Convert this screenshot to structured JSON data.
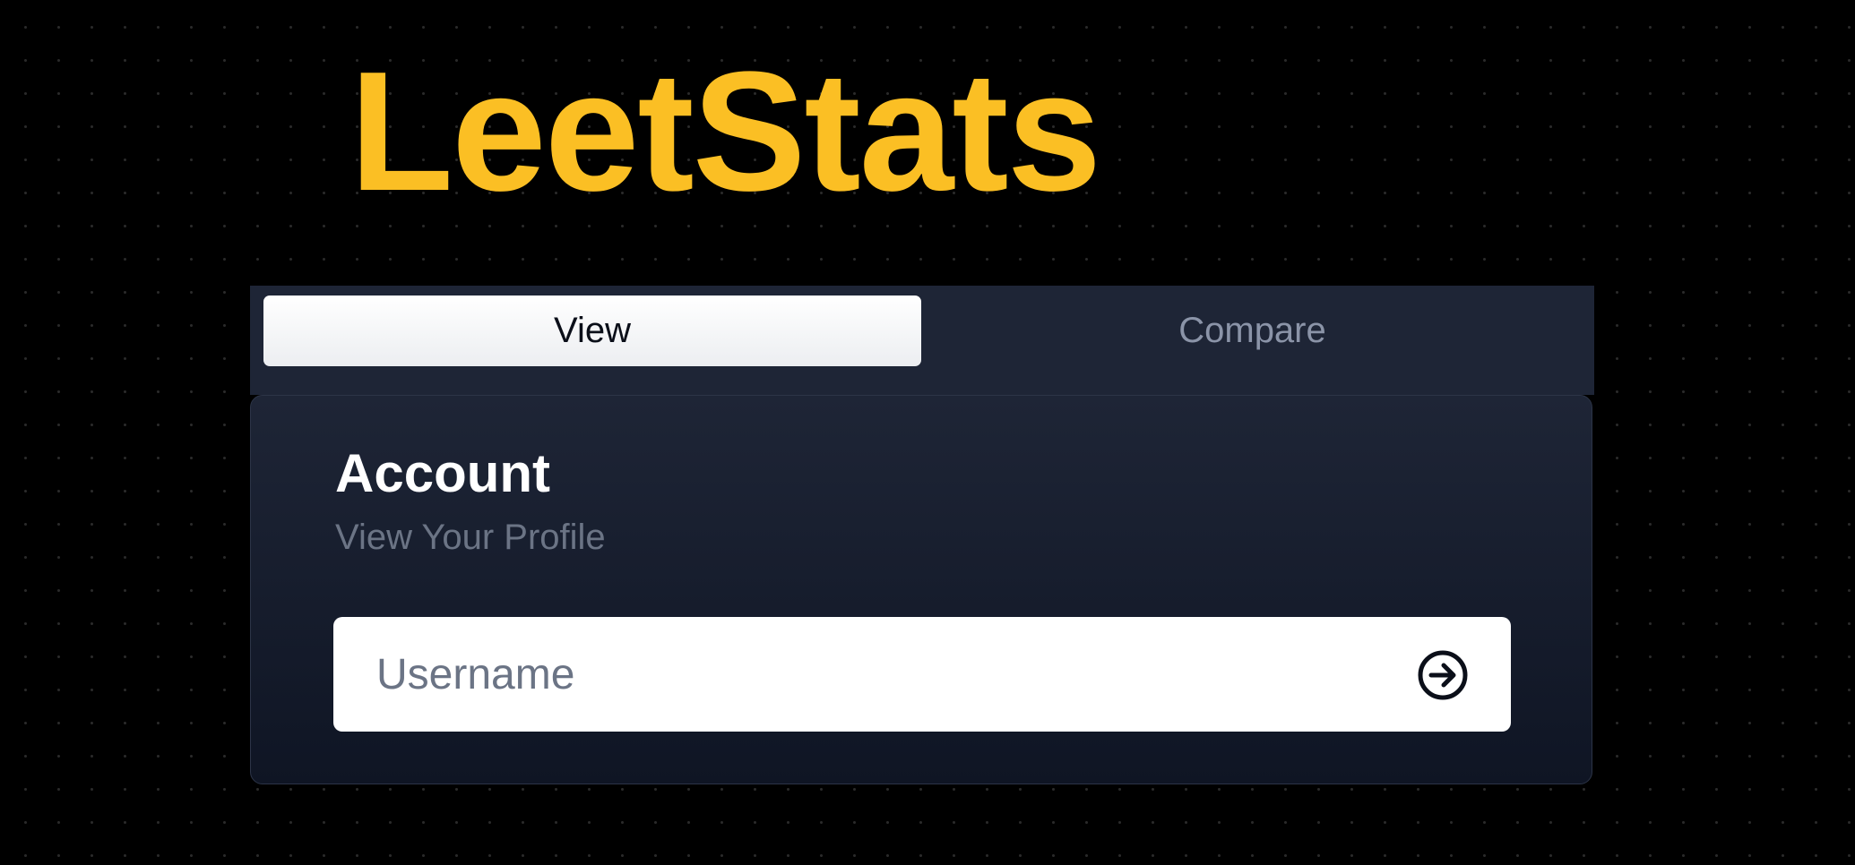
{
  "app": {
    "title": "LeetStats"
  },
  "tabs": [
    {
      "label": "View",
      "active": true
    },
    {
      "label": "Compare",
      "active": false
    }
  ],
  "card": {
    "title": "Account",
    "subtitle": "View Your Profile",
    "username_input": {
      "value": "",
      "placeholder": "Username"
    },
    "submit_icon": "arrow-right-circle-icon"
  },
  "colors": {
    "accent": "#fbbf24",
    "background": "#000000",
    "panel": "#1e2536",
    "active_tab": "#ffffff",
    "muted_text": "#6b7485"
  }
}
